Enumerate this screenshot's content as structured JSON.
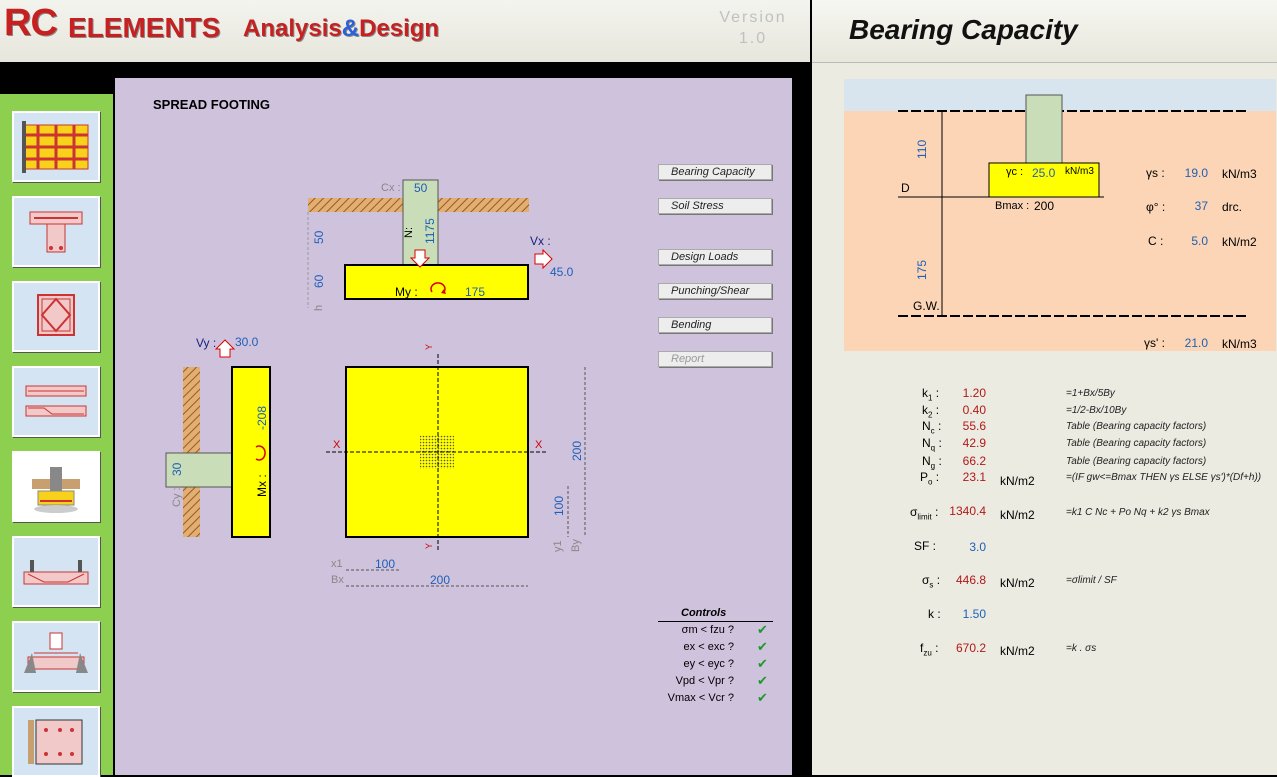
{
  "header": {
    "logo_rc": "RC",
    "logo_elements": "ELEMENTS",
    "logo_analysis": "Analysis",
    "logo_amp": "&",
    "logo_design": "Design",
    "version_line1": "Version",
    "version_line2": "1.0"
  },
  "sidebar": {
    "items": [
      {
        "name": "slab-grid-icon"
      },
      {
        "name": "tbeam-icon"
      },
      {
        "name": "column-section-icon"
      },
      {
        "name": "beam-reinforcement-icon"
      },
      {
        "name": "spread-footing-icon"
      },
      {
        "name": "girder-icon"
      },
      {
        "name": "corbel-icon"
      },
      {
        "name": "wall-icon"
      }
    ]
  },
  "center": {
    "title": "SPREAD FOOTING",
    "buttons": {
      "bearing": "Bearing Capacity",
      "soil": "Soil Stress",
      "loads": "Design Loads",
      "punching": "Punching/Shear",
      "bending": "Bending",
      "report": "Report"
    },
    "elevation": {
      "cx_label": "Cx :",
      "cx": "50",
      "n_label": "N:",
      "n": "1175",
      "vx_label": "Vx :",
      "vx": "45.0",
      "h50": "50",
      "h60": "60",
      "h_label": "h",
      "my_label": "My :",
      "my": "175"
    },
    "side": {
      "vy_label": "Vy :",
      "vy": "30.0",
      "cy": "30",
      "cy_label": "Cy :",
      "mx_label": "Mx :",
      "mx": "-208"
    },
    "plan": {
      "x_label": "X",
      "y_label": "Y",
      "x1_label": "x1",
      "x1": "100",
      "bx_label": "Bx",
      "bx": "200",
      "y1_label": "y1",
      "y1": "100",
      "by_label": "By",
      "by": "200"
    },
    "controls": {
      "title": "Controls",
      "items": [
        {
          "label": "σm < fzu ?",
          "ok": "✔"
        },
        {
          "label": "ex < exc ?",
          "ok": "✔"
        },
        {
          "label": "ey < eyc ?",
          "ok": "✔"
        },
        {
          "label": "Vpd < Vpr ?",
          "ok": "✔"
        },
        {
          "label": "Vmax < Vcr ?",
          "ok": "✔"
        }
      ]
    }
  },
  "right": {
    "title": "Bearing Capacity",
    "diagram": {
      "h110": "110",
      "h175": "175",
      "d_label": "D",
      "gw_label": "G.W.",
      "gc_label": "γc :",
      "gc": "25.0",
      "gc_unit": "kN/m3",
      "bmax_label": "Bmax :",
      "bmax": "200",
      "gs_label": "γs :",
      "gs": "19.0",
      "gs_unit": "kN/m3",
      "phi_label": "φ° :",
      "phi": "37",
      "phi_unit": "drc.",
      "c_label": "C :",
      "c": "5.0",
      "c_unit": "kN/m2",
      "gs2_label": "γs' :",
      "gs2": "21.0",
      "gs2_unit": "kN/m3"
    },
    "results": {
      "k1": "1.20",
      "k1_f": "=1+Bx/5By",
      "k2": "0.40",
      "k2_f": "=1/2-Bx/10By",
      "nc": "55.6",
      "nc_f": "Table (Bearing capacity factors)",
      "nq": "42.9",
      "nq_f": "Table (Bearing capacity factors)",
      "ng": "66.2",
      "ng_f": "Table (Bearing capacity factors)",
      "po": "23.1",
      "po_unit": "kN/m2",
      "po_f": "=(IF gw<=Bmax THEN γs ELSE γs')*(Df+h))",
      "slim": "1340.4",
      "slim_unit": "kN/m2",
      "slim_f": "=k1 C Nc + Po Nq + k2 γs Bmax",
      "sf": "3.0",
      "ss": "446.8",
      "ss_unit": "kN/m2",
      "ss_f": "=σlimit / SF",
      "k": "1.50",
      "fzu": "670.2",
      "fzu_unit": "kN/m2",
      "fzu_f": "=k . σs"
    }
  }
}
